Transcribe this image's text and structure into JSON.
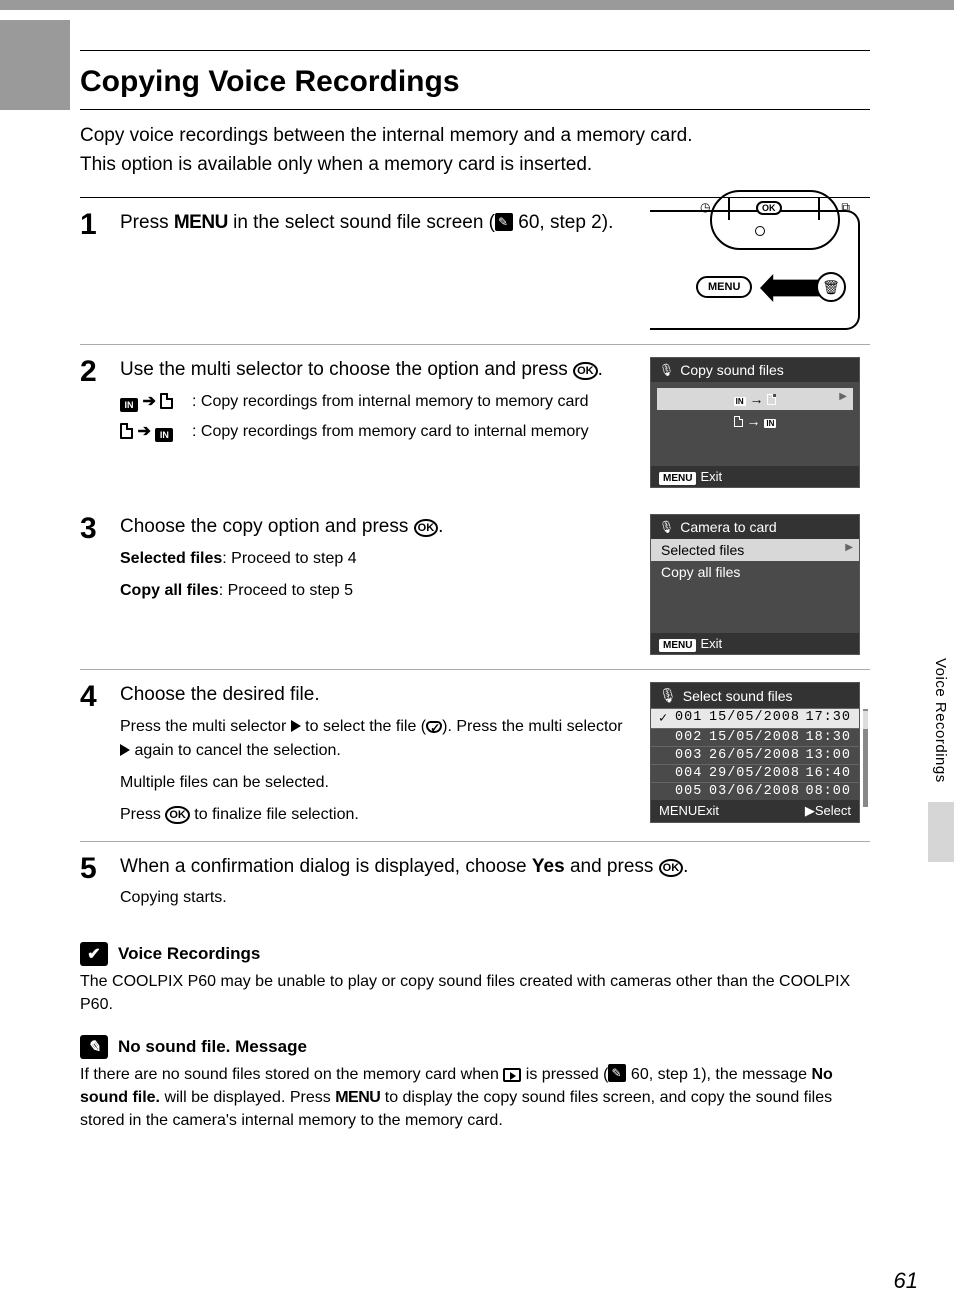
{
  "side_tab": "Voice Recordings",
  "page_number": "61",
  "title": "Copying Voice Recordings",
  "intro_l1": "Copy voice recordings between the internal memory and a memory card.",
  "intro_l2": "This option is available only when a memory card is inserted.",
  "step1": {
    "num": "1",
    "text_a": "Press ",
    "menu": "MENU",
    "text_b": " in the select sound file screen (",
    "ref": " 60, step 2).",
    "diagram": {
      "ok": "OK",
      "menu": "MENU"
    }
  },
  "step2": {
    "num": "2",
    "lead_a": "Use the multi selector to choose the option and press ",
    "ok": "OK",
    "lead_b": ".",
    "opt1": ": Copy recordings from internal memory to memory card",
    "opt2": ": Copy recordings from memory card to internal memory",
    "lcd": {
      "title": "Copy sound files",
      "in": "IN",
      "exit": "Exit",
      "menu": "MENU"
    }
  },
  "step3": {
    "num": "3",
    "lead_a": "Choose the copy option and press ",
    "ok": "OK",
    "lead_b": ".",
    "d1a": "Selected files",
    "d1b": ": Proceed to step 4",
    "d2a": "Copy all files",
    "d2b": ": Proceed to step 5",
    "lcd": {
      "title": "Camera to card",
      "opt1": "Selected files",
      "opt2": "Copy all files",
      "exit": "Exit",
      "menu": "MENU"
    }
  },
  "step4": {
    "num": "4",
    "lead": "Choose the desired file.",
    "d1a": "Press the multi selector ",
    "d1b": " to select the file (",
    "d1c": "). Press the multi selector ",
    "d1d": " again to cancel the selection.",
    "d2": "Multiple files can be selected.",
    "d3a": "Press ",
    "ok": "OK",
    "d3b": " to finalize file selection.",
    "lcd": {
      "title": "Select sound files",
      "rows": [
        {
          "num": "001",
          "date": "15/05/2008",
          "time": "17:30",
          "sel": true
        },
        {
          "num": "002",
          "date": "15/05/2008",
          "time": "18:30",
          "sel": false
        },
        {
          "num": "003",
          "date": "26/05/2008",
          "time": "13:00",
          "sel": false
        },
        {
          "num": "004",
          "date": "29/05/2008",
          "time": "16:40",
          "sel": false
        },
        {
          "num": "005",
          "date": "03/06/2008",
          "time": "08:00",
          "sel": false
        }
      ],
      "exit": "Exit",
      "menu": "MENU",
      "select": "Select"
    }
  },
  "step5": {
    "num": "5",
    "lead_a": "When a confirmation dialog is displayed, choose ",
    "yes": "Yes",
    "lead_b": " and press ",
    "ok": "OK",
    "lead_c": ".",
    "d1": "Copying starts."
  },
  "note1": {
    "icon": "✔",
    "title": "Voice Recordings",
    "body": "The COOLPIX P60 may be unable to play or copy sound files created with cameras other than the COOLPIX P60."
  },
  "note2": {
    "icon": "✎",
    "title_a": "No sound file.",
    "title_b": " Message",
    "body_a": "If there are no sound files stored on the memory card when ",
    "body_b": " is pressed (",
    "body_c": " 60, step 1), the message ",
    "body_bold": "No sound file.",
    "body_d": " will be displayed. Press ",
    "menu": "MENU",
    "body_e": " to display the copy sound files screen, and copy the sound files stored in the camera's internal memory to the memory card."
  }
}
